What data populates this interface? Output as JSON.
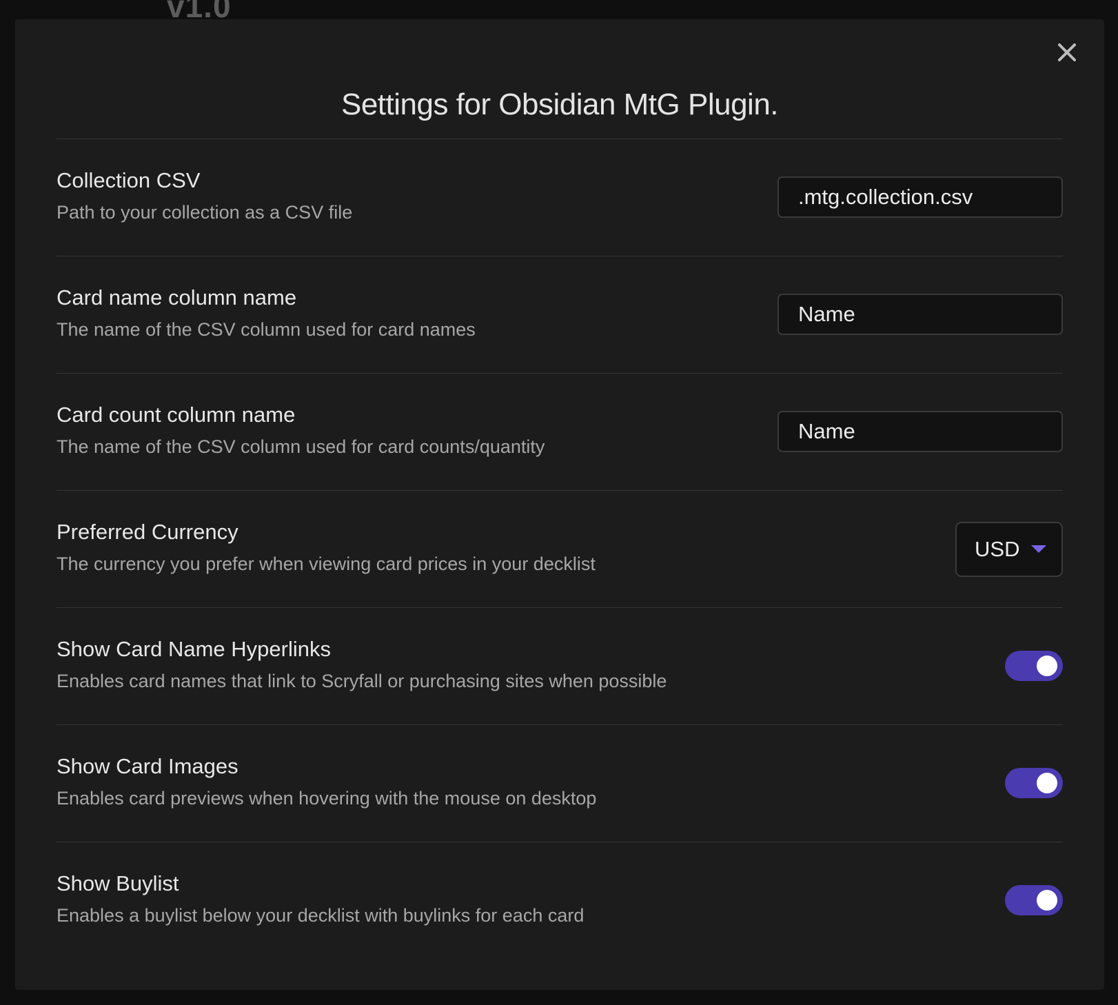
{
  "background": {
    "partial_heading": "v1.0"
  },
  "modal": {
    "title": "Settings for Obsidian MtG Plugin.",
    "close_icon": "close-icon"
  },
  "colors": {
    "accent": "#4a3bb0",
    "caret": "#7b63e6",
    "modal_bg": "#1c1c1c",
    "input_bg": "#121212"
  },
  "settings": {
    "collection_csv": {
      "name": "Collection CSV",
      "description": "Path to your collection as a CSV file",
      "value": ".mtg.collection.csv"
    },
    "card_name_column": {
      "name": "Card name column name",
      "description": "The name of the CSV column used for card names",
      "value": "Name"
    },
    "card_count_column": {
      "name": "Card count column name",
      "description": "The name of the CSV column used for card counts/quantity",
      "value": "Name"
    },
    "preferred_currency": {
      "name": "Preferred Currency",
      "description": "The currency you prefer when viewing card prices in your decklist",
      "selected": "USD"
    },
    "show_card_name_hyperlinks": {
      "name": "Show Card Name Hyperlinks",
      "description": "Enables card names that link to Scryfall or purchasing sites when possible",
      "enabled": true
    },
    "show_card_images": {
      "name": "Show Card Images",
      "description": "Enables card previews when hovering with the mouse on desktop",
      "enabled": true
    },
    "show_buylist": {
      "name": "Show Buylist",
      "description": "Enables a buylist below your decklist with buylinks for each card",
      "enabled": true
    }
  }
}
